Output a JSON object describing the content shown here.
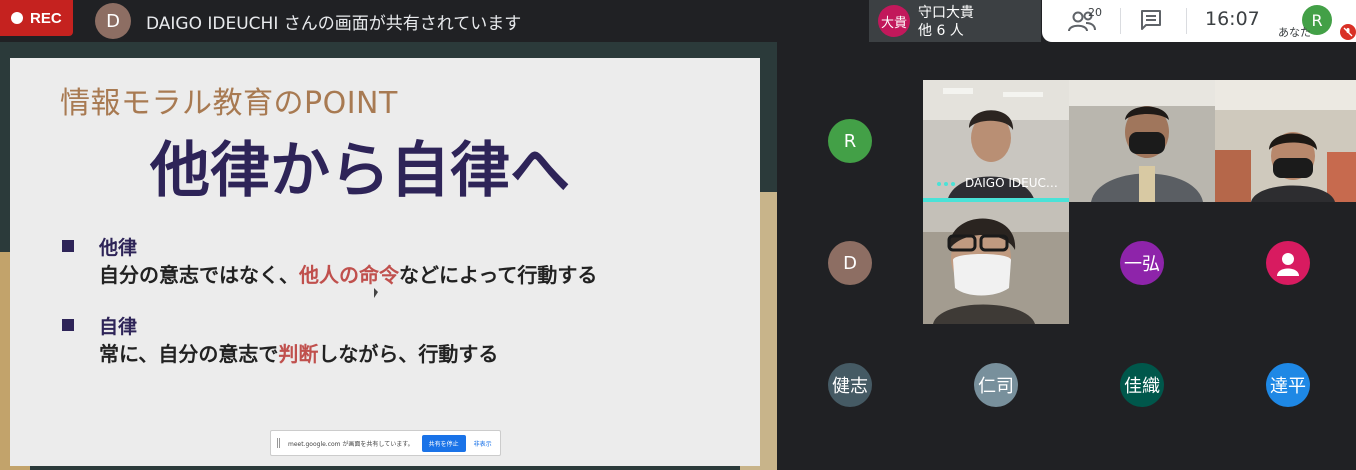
{
  "top_bar": {
    "rec_label": "REC",
    "presenter_initial": "D",
    "presenter_text": "DAIGO IDEUCHI さんの画面が共有されています",
    "others": {
      "initials": "大貴",
      "name": "守口大貴",
      "count_text": "他 6 人"
    },
    "people_count": "20",
    "clock": "16:07",
    "self_initial": "R",
    "self_label": "あなた"
  },
  "slide": {
    "kicker": "情報モラル教育のPOINT",
    "title": "他律から自律へ",
    "bullets": [
      {
        "head": "他律",
        "body_pre": "自分の意志ではなく、",
        "body_hl": "他人の命令",
        "body_post": "などによって行動する"
      },
      {
        "head": "自律",
        "body_pre": "常に、自分の意志で",
        "body_hl": "判断",
        "body_post": "しながら、行動する"
      }
    ]
  },
  "share_bar": {
    "text": "meet.google.com が画面を共有しています。",
    "stop_label": "共有を停止",
    "hide_label": "非表示"
  },
  "participants": {
    "r": {
      "initial": "R",
      "color": "#43a047"
    },
    "daigo": {
      "name": "DAIGO IDEUC…"
    },
    "d": {
      "initial": "D",
      "color": "#8d6e63"
    },
    "ichihiro": {
      "initial": "一弘",
      "color": "#8e24aa"
    },
    "anon": {
      "color": "#d81b60"
    },
    "kenji": {
      "initial": "健志",
      "color": "#455a64"
    },
    "hitoshi": {
      "initial": "仁司",
      "color": "#78909c"
    },
    "kaori": {
      "initial": "佳織",
      "color": "#00574b"
    },
    "tappei": {
      "initial": "達平",
      "color": "#1e88e5"
    }
  }
}
